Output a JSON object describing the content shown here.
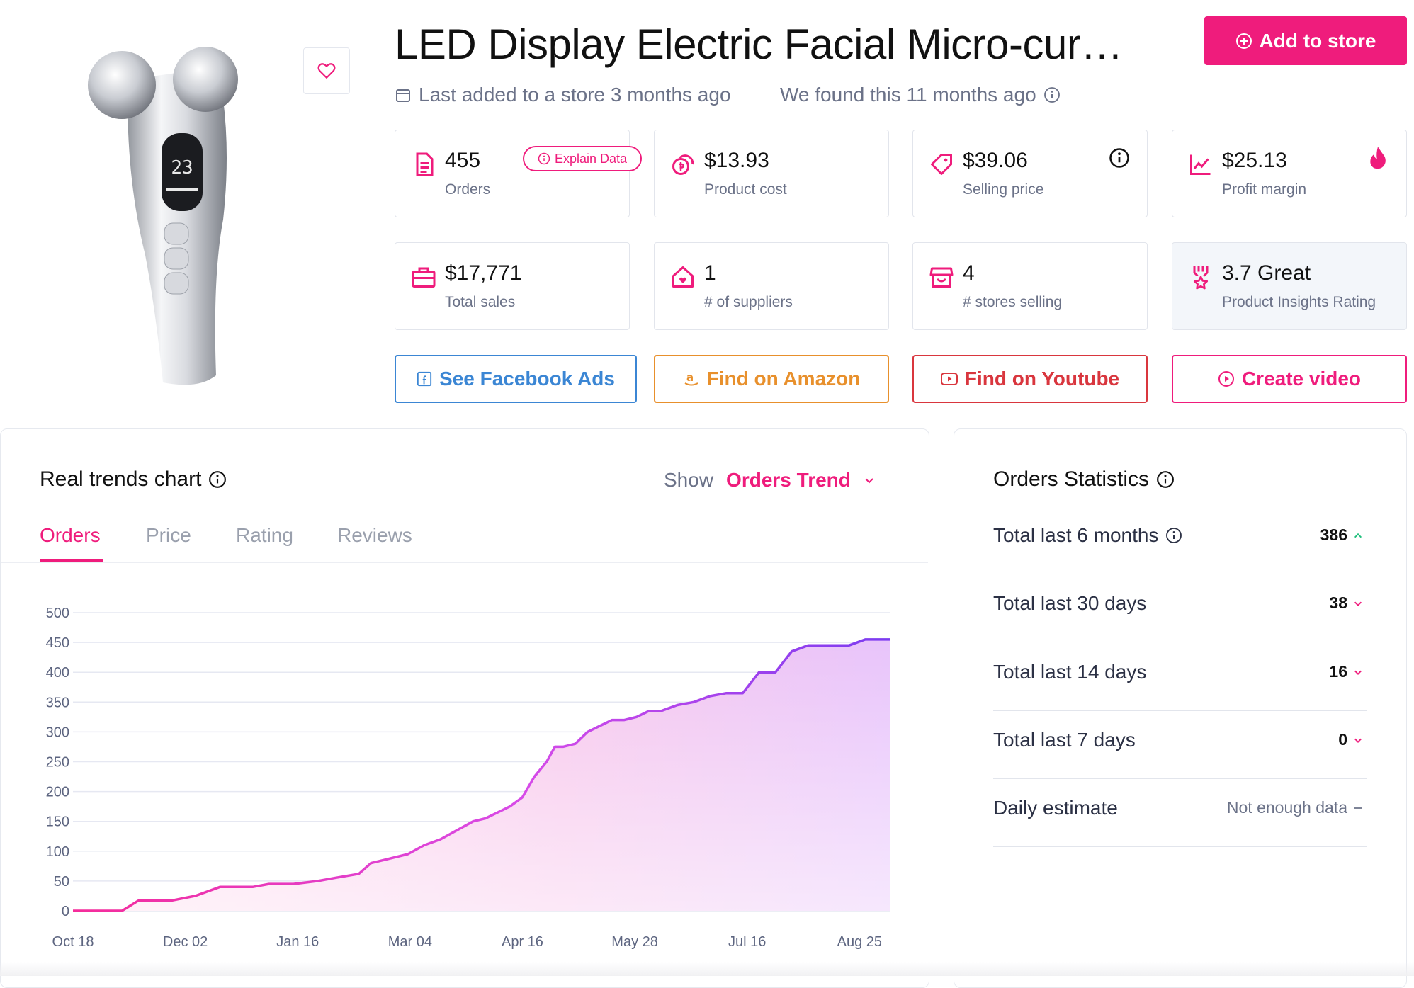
{
  "product": {
    "title": "LED Display Electric Facial Micro-cur…",
    "last_added": "Last added to a store 3 months ago",
    "found": "We found this 11 months ago",
    "add_button": "Add to store"
  },
  "metrics": [
    {
      "value": "455",
      "label": "Orders",
      "icon": "document-icon"
    },
    {
      "value": "$13.93",
      "label": "Product cost",
      "icon": "coins-icon"
    },
    {
      "value": "$39.06",
      "label": "Selling price",
      "icon": "price-tag-icon"
    },
    {
      "value": "$25.13",
      "label": "Profit margin",
      "icon": "trend-up-icon"
    },
    {
      "value": "$17,771",
      "label": "Total sales",
      "icon": "briefcase-icon"
    },
    {
      "value": "1",
      "label": "# of suppliers",
      "icon": "supplier-house-icon"
    },
    {
      "value": "4",
      "label": "# stores selling",
      "icon": "store-icon"
    },
    {
      "value": "3.7 Great",
      "label": "Product Insights Rating",
      "icon": "award-icon"
    }
  ],
  "explain_chip": "Explain Data",
  "actions": {
    "facebook": "See Facebook Ads",
    "amazon": "Find on Amazon",
    "youtube": "Find on Youtube",
    "video": "Create video"
  },
  "colors": {
    "accent": "#ef1c7c",
    "facebook": "#3b86d4",
    "amazon": "#e8902c",
    "youtube": "#d9363e",
    "line": "#8b3bf0"
  },
  "trends": {
    "title": "Real trends chart",
    "show_label": "Show",
    "show_value": "Orders Trend",
    "tabs": [
      "Orders",
      "Price",
      "Rating",
      "Reviews"
    ],
    "active_tab": "Orders"
  },
  "chart_data": {
    "type": "area",
    "title": "",
    "xlabel": "",
    "ylabel": "",
    "ylim": [
      0,
      500
    ],
    "y_ticks": [
      0,
      50,
      100,
      150,
      200,
      250,
      300,
      350,
      400,
      450,
      500
    ],
    "x_ticks": [
      "Oct 18",
      "Dec 02",
      "Jan 16",
      "Mar 04",
      "Apr 16",
      "May 28",
      "Jul 16",
      "Aug 25"
    ],
    "grid": true,
    "legend": "none",
    "series": [
      {
        "x": [
          0,
          6,
          8,
          11.5,
          12,
          15,
          18,
          22,
          24,
          27,
          30,
          32,
          35,
          36.5,
          38,
          41,
          43,
          45,
          47,
          49,
          50.5,
          52,
          53.5,
          55,
          56.5,
          58,
          59,
          60,
          61.5,
          63,
          64.5,
          66,
          67.5,
          69,
          70.5,
          72,
          73,
          74,
          76,
          78,
          80,
          82,
          84,
          86,
          88,
          90,
          91.5,
          93,
          95,
          97,
          100
        ],
        "y": [
          0,
          0,
          17,
          17,
          17,
          25,
          40,
          40,
          45,
          45,
          50,
          55,
          62,
          80,
          85,
          95,
          110,
          120,
          135,
          150,
          155,
          165,
          175,
          190,
          225,
          250,
          275,
          275,
          280,
          300,
          310,
          320,
          320,
          325,
          335,
          335,
          340,
          345,
          350,
          360,
          365,
          365,
          400,
          400,
          435,
          445,
          445,
          445,
          445,
          455,
          455
        ]
      }
    ]
  },
  "stats": {
    "title": "Orders Statistics",
    "rows": [
      {
        "label": "Total last 6 months",
        "value": "386",
        "trend": "up"
      },
      {
        "label": "Total last 30 days",
        "value": "38",
        "trend": "down"
      },
      {
        "label": "Total last 14 days",
        "value": "16",
        "trend": "down"
      },
      {
        "label": "Total last 7 days",
        "value": "0",
        "trend": "down"
      },
      {
        "label": "Daily estimate",
        "value": "Not enough data",
        "trend": "none"
      }
    ]
  }
}
